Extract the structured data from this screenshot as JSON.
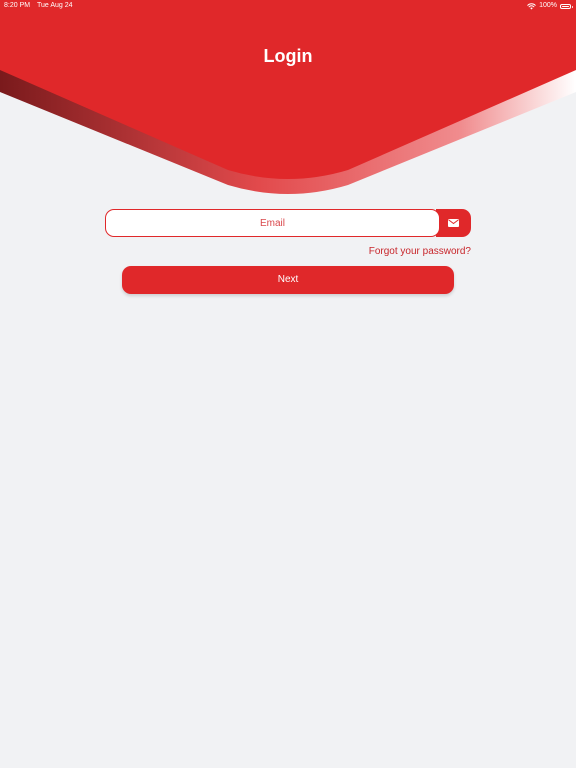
{
  "status_bar": {
    "time": "8:20 PM",
    "date": "Tue Aug 24",
    "battery": "100%",
    "battery_level": 1.0,
    "icons": [
      "wifi-icon",
      "battery-icon"
    ]
  },
  "header": {
    "title": "Login"
  },
  "login_form": {
    "email_placeholder": "Email",
    "email_value": "",
    "email_icon": "envelope-icon",
    "forgot_password": "Forgot your password?",
    "next_label": "Next"
  },
  "colors": {
    "brand_red": "#e0282a",
    "dark_red": "#7a1a1c",
    "background": "#f1f2f4",
    "link_red": "#c8262b"
  }
}
